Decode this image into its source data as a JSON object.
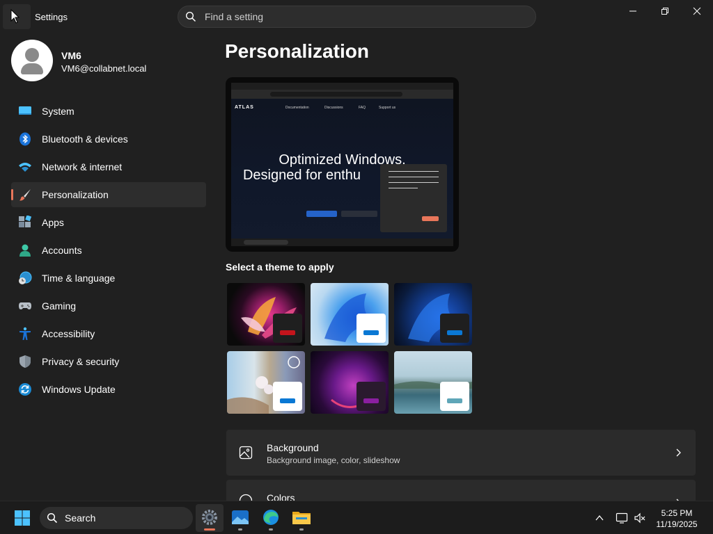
{
  "window": {
    "title": "Settings",
    "search_placeholder": "Find a setting"
  },
  "user": {
    "name": "VM6",
    "email": "VM6@collabnet.local"
  },
  "sidebar": {
    "items": [
      {
        "label": "System",
        "icon": "monitor-icon"
      },
      {
        "label": "Bluetooth & devices",
        "icon": "bluetooth-icon"
      },
      {
        "label": "Network & internet",
        "icon": "wifi-icon"
      },
      {
        "label": "Personalization",
        "icon": "paintbrush-icon",
        "active": true
      },
      {
        "label": "Apps",
        "icon": "apps-icon"
      },
      {
        "label": "Accounts",
        "icon": "person-icon"
      },
      {
        "label": "Time & language",
        "icon": "globe-clock-icon"
      },
      {
        "label": "Gaming",
        "icon": "gamepad-icon"
      },
      {
        "label": "Accessibility",
        "icon": "accessibility-icon"
      },
      {
        "label": "Privacy & security",
        "icon": "shield-icon"
      },
      {
        "label": "Windows Update",
        "icon": "update-icon"
      }
    ]
  },
  "main": {
    "title": "Personalization",
    "preview": {
      "logo": "ATLAS",
      "nav_links": [
        "Documentation",
        "Discussions",
        "FAQ",
        "Support us"
      ],
      "headline_1": "Optimized Windows.",
      "headline_2": "Designed for enthu"
    },
    "themes_label": "Select a theme to apply",
    "themes": [
      {
        "name": "theme-flower",
        "accent": "#c4141c"
      },
      {
        "name": "theme-bloom-light",
        "accent": "#0a78d4"
      },
      {
        "name": "theme-bloom-dark",
        "accent": "#0a78d4"
      },
      {
        "name": "theme-captured-motion",
        "accent": "#0a78d4"
      },
      {
        "name": "theme-glow",
        "accent": "#8a1fa0"
      },
      {
        "name": "theme-sunrise-lake",
        "accent": "#5fa6b8"
      }
    ],
    "cards": [
      {
        "title": "Background",
        "subtitle": "Background image, color, slideshow"
      },
      {
        "title": "Colors",
        "subtitle": ""
      }
    ]
  },
  "taskbar": {
    "search_label": "Search",
    "time": "5:25 PM",
    "date": "11/19/2025"
  },
  "colors": {
    "accent": "#e8765a",
    "background": "#202020",
    "card": "#2b2b2b"
  }
}
